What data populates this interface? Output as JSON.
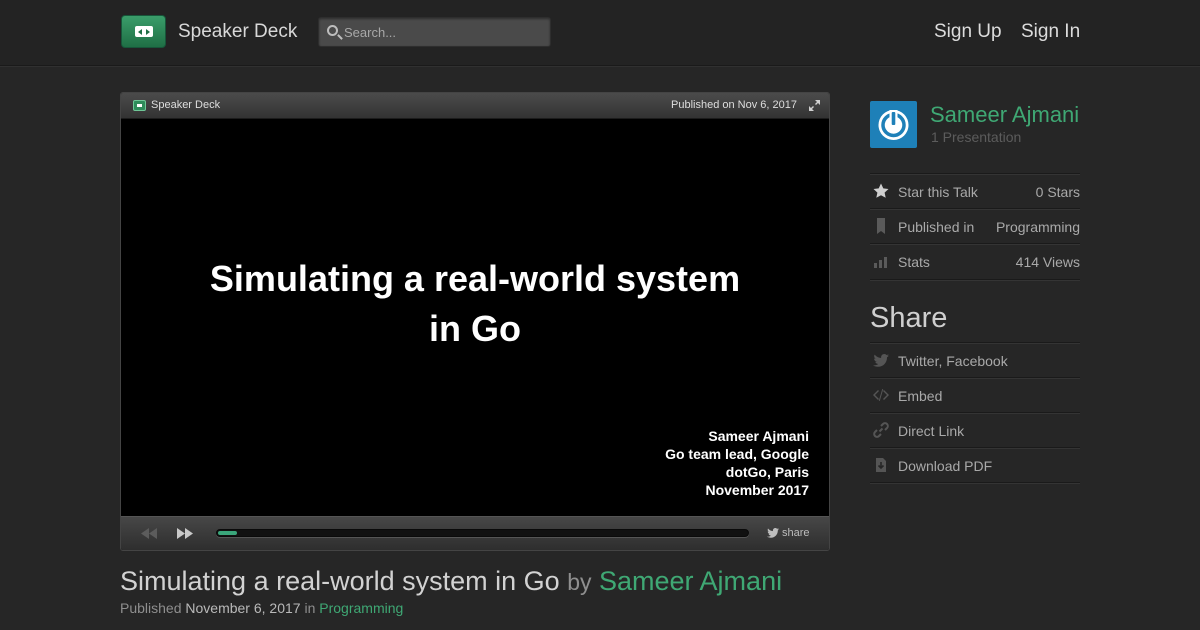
{
  "header": {
    "brand": "Speaker Deck",
    "search_placeholder": "Search...",
    "sign_up": "Sign Up",
    "sign_in": "Sign In"
  },
  "player": {
    "brand": "Speaker Deck",
    "published": "Published on Nov 6, 2017",
    "slide": {
      "title_line1": "Simulating a real-world system",
      "title_line2": "in Go",
      "credits": [
        "Sameer Ajmani",
        "Go team lead, Google",
        "dotGo, Paris",
        "November 2017"
      ]
    },
    "progress_fraction": 0.035,
    "share_label": "share"
  },
  "talk": {
    "title": "Simulating a real-world system in Go",
    "by_label": "by",
    "author": "Sameer Ajmani",
    "published_label": "Published",
    "published_date": "November 6, 2017",
    "in_label": "in",
    "category": "Programming"
  },
  "sidebar": {
    "author_name": "Sameer Ajmani",
    "presentations": "1 Presentation",
    "star_label": "Star this Talk",
    "stars": "0 Stars",
    "published_in_label": "Published in",
    "category": "Programming",
    "stats_label": "Stats",
    "views": "414 Views",
    "share_heading": "Share",
    "share_items": [
      "Twitter, Facebook",
      "Embed",
      "Direct Link",
      "Download PDF"
    ]
  },
  "colors": {
    "accent": "#3fa874",
    "background": "#262626",
    "avatar": "#1e80b8"
  },
  "icons": {
    "logo": "speaker-deck-logo-icon",
    "search": "search-icon",
    "star": "star-icon",
    "bookmark": "bookmark-icon",
    "stats": "bar-chart-icon",
    "twitter": "twitter-bird-icon",
    "embed": "code-icon",
    "link": "link-icon",
    "download": "download-icon"
  }
}
